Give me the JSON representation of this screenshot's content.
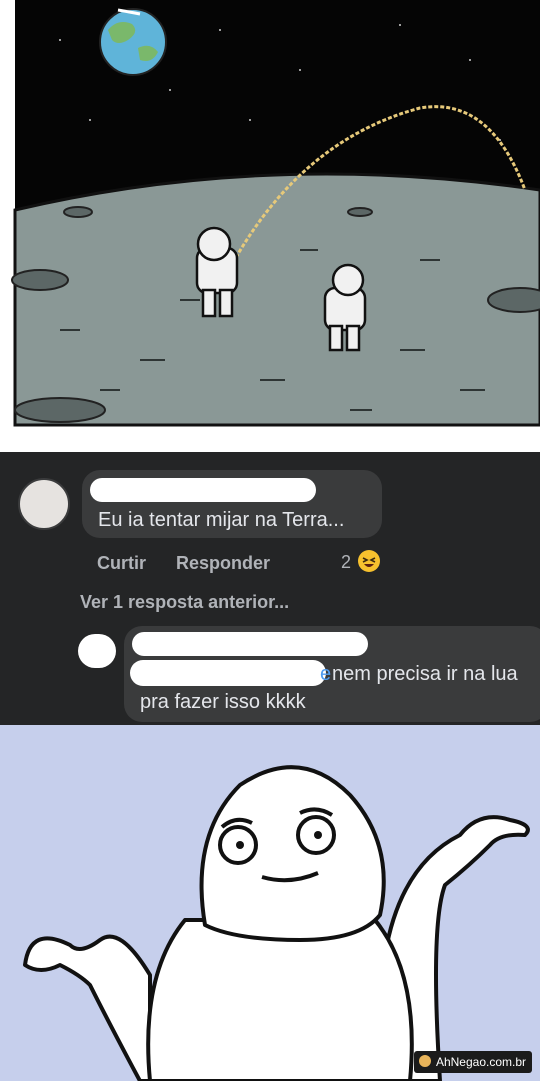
{
  "comic": {
    "scene": "astronauts-on-moon",
    "colors": {
      "sky": "#050505",
      "ground": "#8a9896",
      "earth_land": "#7ab86b",
      "earth_sea": "#5fb4d9",
      "arc": "#e6c97a"
    }
  },
  "comment_main": {
    "text": "Eu ia tentar mijar na Terra...",
    "actions": {
      "like": "Curtir",
      "reply": "Responder"
    },
    "reaction_count": "2",
    "reaction_icon": "laughing-emoji"
  },
  "view_previous": "Ver 1 resposta anterior...",
  "reply": {
    "mention_fragment": "e",
    "text_line1": "nem precisa ir na lua",
    "text_line2": "pra fazer isso kkkk"
  },
  "meme": {
    "character": "shrug-face",
    "watermark": "AhNegao.com.br",
    "colors": {
      "background": "#c6cfec",
      "figure": "#ffffff"
    }
  }
}
